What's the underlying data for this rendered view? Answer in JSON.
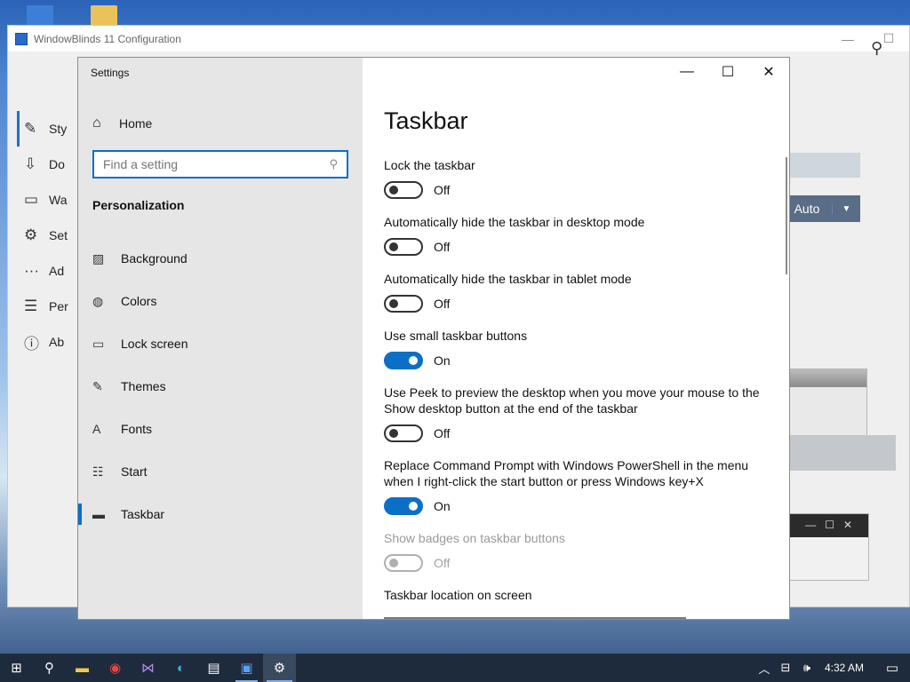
{
  "wb_window": {
    "title": "WindowBlinds 11 Configuration",
    "minimize": "—",
    "maximize": "☐",
    "search_icon": "⚲",
    "side_items": [
      {
        "label": "Sty",
        "icon": "brush-icon"
      },
      {
        "label": "Do",
        "icon": "download-icon"
      },
      {
        "label": "Wa",
        "icon": "wallpaper-icon"
      },
      {
        "label": "Set",
        "icon": "gear-icon"
      },
      {
        "label": "Ad",
        "icon": "more-icon"
      },
      {
        "label": "Per",
        "icon": "list-icon"
      },
      {
        "label": "Ab",
        "icon": "info-icon"
      }
    ],
    "auto_label": "Auto"
  },
  "settings_window": {
    "window_title": "Settings",
    "home_label": "Home",
    "search_placeholder": "Find a setting",
    "section_label": "Personalization",
    "nav_items": [
      {
        "label": "Background",
        "icon": "picture-icon"
      },
      {
        "label": "Colors",
        "icon": "palette-icon"
      },
      {
        "label": "Lock screen",
        "icon": "lock-screen-icon"
      },
      {
        "label": "Themes",
        "icon": "themes-icon"
      },
      {
        "label": "Fonts",
        "icon": "fonts-icon"
      },
      {
        "label": "Start",
        "icon": "start-icon"
      },
      {
        "label": "Taskbar",
        "icon": "taskbar-icon"
      }
    ],
    "active_nav": "Taskbar"
  },
  "content": {
    "page_title": "Taskbar",
    "settings": [
      {
        "label": "Lock the taskbar",
        "state": "Off",
        "on": false,
        "enabled": true
      },
      {
        "label": "Automatically hide the taskbar in desktop mode",
        "state": "Off",
        "on": false,
        "enabled": true
      },
      {
        "label": "Automatically hide the taskbar in tablet mode",
        "state": "Off",
        "on": false,
        "enabled": true
      },
      {
        "label": "Use small taskbar buttons",
        "state": "On",
        "on": true,
        "enabled": true
      },
      {
        "label": "Use Peek to preview the desktop when you move your mouse to the Show desktop button at the end of the taskbar",
        "state": "Off",
        "on": false,
        "enabled": true
      },
      {
        "label": "Replace Command Prompt with Windows PowerShell in the menu when I right-click the start button or press Windows key+X",
        "state": "On",
        "on": true,
        "enabled": true
      },
      {
        "label": "Show badges on taskbar buttons",
        "state": "Off",
        "on": false,
        "enabled": false
      },
      {
        "label": "Taskbar location on screen",
        "state": "",
        "on": false,
        "enabled": true
      }
    ]
  },
  "taskbar": {
    "time": "4:32 AM",
    "accent_color": "#0b6fc6"
  }
}
